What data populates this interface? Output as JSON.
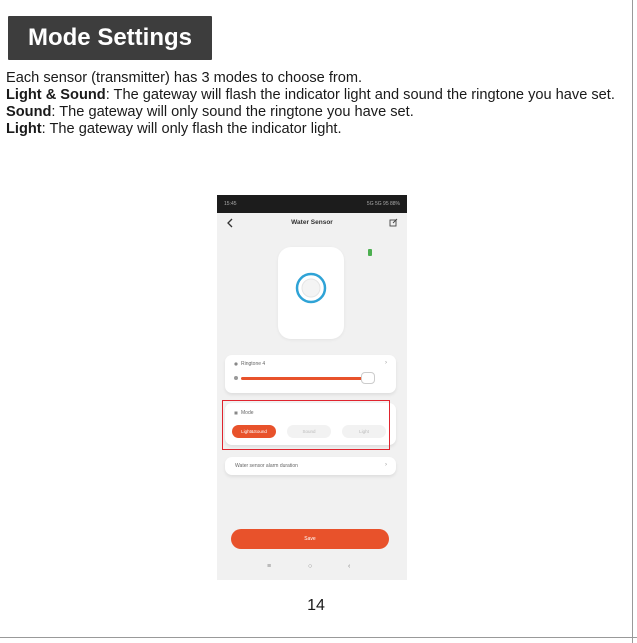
{
  "section": {
    "title": "Mode Settings"
  },
  "intro": "Each sensor (transmitter) has 3 modes to choose from.",
  "modes": [
    {
      "name": "Light & Sound",
      "description": ": The gateway will flash the indicator light and sound the ringtone you have set."
    },
    {
      "name": "Sound",
      "description": ": The gateway will only sound the ringtone you have set."
    },
    {
      "name": "Light",
      "description": ": The gateway will only flash the indicator light."
    }
  ],
  "phone": {
    "status_time": "15:45",
    "status_right": "5G 5G 95 88%",
    "screen_title": "Water Sensor",
    "ringtone_label": "Ringtone 4",
    "volume_level": 0.9,
    "mode_label": "Mode",
    "mode_options": [
      "Light&Sound",
      "Sound",
      "Light"
    ],
    "selected_mode": "Light&Sound",
    "timing_label": "Water sensor alarm duration",
    "save_label": "Save",
    "colors": {
      "accent": "#e8522b",
      "highlight_box": "#e0242e",
      "sensor_ring": "#2fa3d6"
    },
    "icons": [
      "back-icon",
      "edit-icon",
      "battery-icon",
      "bell-icon",
      "volume-icon",
      "mode-icon",
      "chevron-right-icon"
    ]
  },
  "page_number": "14"
}
